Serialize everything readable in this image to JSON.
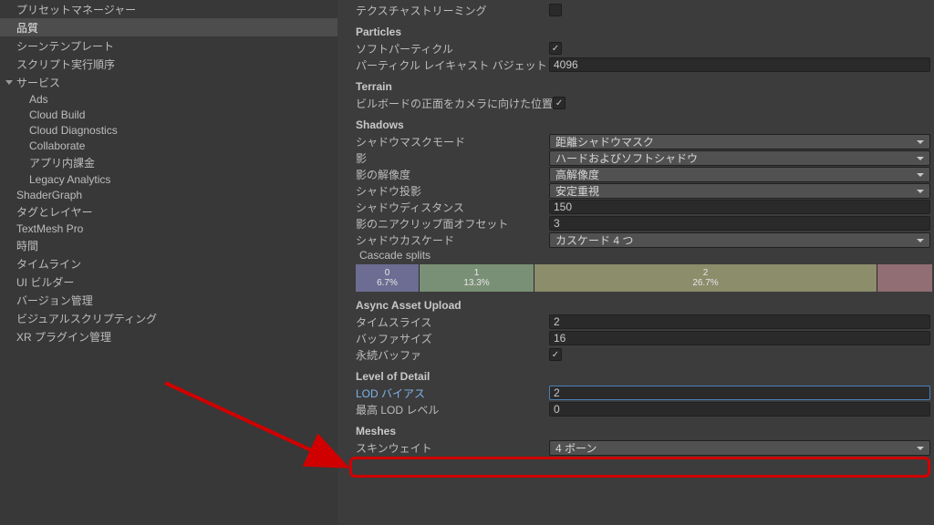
{
  "sidebar": {
    "items": [
      {
        "label": "プリセットマネージャー",
        "depth": 1
      },
      {
        "label": "品質",
        "depth": 1,
        "selected": true
      },
      {
        "label": "シーンテンプレート",
        "depth": 1
      },
      {
        "label": "スクリプト実行順序",
        "depth": 1
      }
    ],
    "servicesLabel": "サービス",
    "services": [
      {
        "label": "Ads"
      },
      {
        "label": "Cloud Build"
      },
      {
        "label": "Cloud Diagnostics"
      },
      {
        "label": "Collaborate"
      },
      {
        "label": "アプリ内課金"
      },
      {
        "label": "Legacy Analytics"
      }
    ],
    "items2": [
      {
        "label": "ShaderGraph"
      },
      {
        "label": "タグとレイヤー"
      },
      {
        "label": "TextMesh Pro"
      },
      {
        "label": "時間"
      },
      {
        "label": "タイムライン"
      },
      {
        "label": "UI ビルダー"
      },
      {
        "label": "バージョン管理"
      },
      {
        "label": "ビジュアルスクリプティング"
      },
      {
        "label": "XR プラグイン管理"
      }
    ]
  },
  "settings": {
    "textureStreamingLabel": "テクスチャストリーミング",
    "particlesHead": "Particles",
    "softParticlesLabel": "ソフトパーティクル",
    "raycastBudgetLabel": "パーティクル レイキャスト バジェット",
    "raycastBudgetValue": "4096",
    "terrainHead": "Terrain",
    "billboardLabel": "ビルボードの正面をカメラに向けた位置",
    "shadowsHead": "Shadows",
    "shadowMaskModeLabel": "シャドウマスクモード",
    "shadowMaskModeValue": "距離シャドウマスク",
    "shadowLabel": "影",
    "shadowValue": "ハードおよびソフトシャドウ",
    "shadowResLabel": "影の解像度",
    "shadowResValue": "高解像度",
    "shadowProjLabel": "シャドウ投影",
    "shadowProjValue": "安定重視",
    "shadowDistLabel": "シャドウディスタンス",
    "shadowDistValue": "150",
    "shadowNearClipLabel": "影のニアクリップ面オフセット",
    "shadowNearClipValue": "3",
    "shadowCascadeLabel": "シャドウカスケード",
    "shadowCascadeValue": "カスケード 4 つ",
    "cascadeSplitsLabel": "Cascade splits",
    "cascade": [
      {
        "i": "0",
        "p": "6.7%"
      },
      {
        "i": "1",
        "p": "13.3%"
      },
      {
        "i": "2",
        "p": "26.7%"
      },
      {
        "i": "",
        "p": ""
      }
    ],
    "asyncHead": "Async Asset Upload",
    "timeSliceLabel": "タイムスライス",
    "timeSliceValue": "2",
    "bufferSizeLabel": "バッファサイズ",
    "bufferSizeValue": "16",
    "persistentBufferLabel": "永続バッファ",
    "lodHead": "Level of Detail",
    "lodBiasLabel": "LOD バイアス",
    "lodBiasValue": "2",
    "maxLodLabel": "最高 LOD レベル",
    "maxLodValue": "0",
    "meshesHead": "Meshes",
    "skinWeightsLabel": "スキンウェイト",
    "skinWeightsValue": "4 ボーン"
  }
}
